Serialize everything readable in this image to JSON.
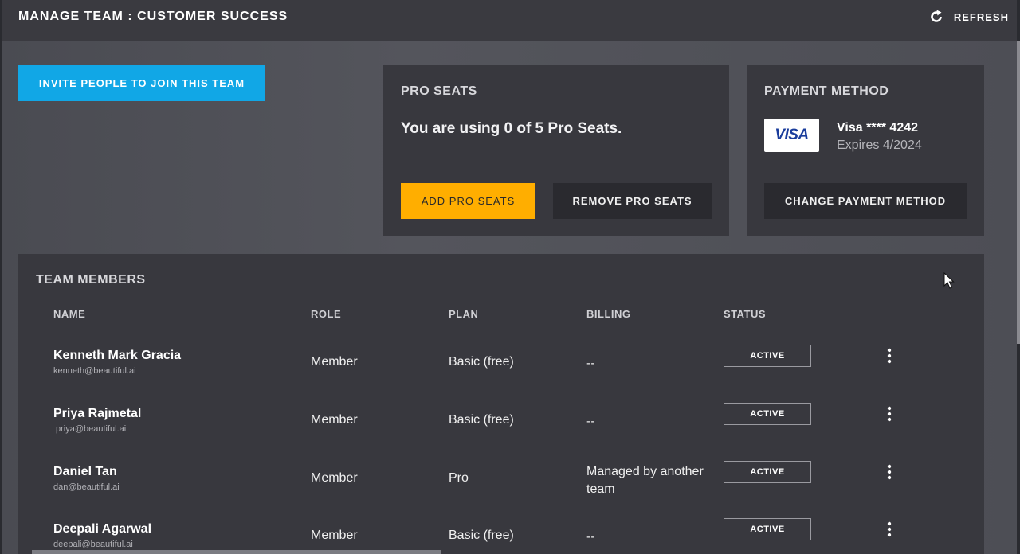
{
  "header": {
    "title": "MANAGE TEAM : CUSTOMER SUCCESS",
    "refresh_label": "REFRESH"
  },
  "invite_button_label": "INVITE PEOPLE TO JOIN THIS TEAM",
  "pro_seats": {
    "heading": "PRO SEATS",
    "usage_text": "You are using 0 of 5 Pro Seats.",
    "add_label": "ADD PRO SEATS",
    "remove_label": "REMOVE PRO SEATS"
  },
  "payment": {
    "heading": "PAYMENT METHOD",
    "card_brand": "VISA",
    "card_number": "Visa **** 4242",
    "expiry": "Expires 4/2024",
    "change_label": "CHANGE PAYMENT METHOD"
  },
  "team": {
    "heading": "TEAM MEMBERS",
    "columns": [
      "NAME",
      "ROLE",
      "PLAN",
      "BILLING",
      "STATUS"
    ],
    "members": [
      {
        "name": "Kenneth Mark Gracia",
        "email": "kenneth@beautiful.ai",
        "role": "Member",
        "plan": "Basic (free)",
        "billing": "--",
        "status": "ACTIVE"
      },
      {
        "name": "Priya Rajmetal",
        "email": "priya@beautiful.ai",
        "role": "Member",
        "plan": "Basic (free)",
        "billing": "--",
        "status": "ACTIVE"
      },
      {
        "name": "Daniel Tan",
        "email": "dan@beautiful.ai",
        "role": "Member",
        "plan": "Pro",
        "billing": "Managed by another team",
        "status": "ACTIVE"
      },
      {
        "name": "Deepali Agarwal",
        "email": "deepali@beautiful.ai",
        "role": "Member",
        "plan": "Basic (free)",
        "billing": "--",
        "status": "ACTIVE"
      }
    ]
  },
  "colors": {
    "accent_blue": "#11a7e6",
    "accent_orange": "#ffae00",
    "card_bg": "#38383e",
    "topbar_bg": "#3a3a40"
  },
  "icons": [
    "refresh-icon",
    "visa-card-icon",
    "more-options-icon",
    "mouse-cursor-icon"
  ]
}
